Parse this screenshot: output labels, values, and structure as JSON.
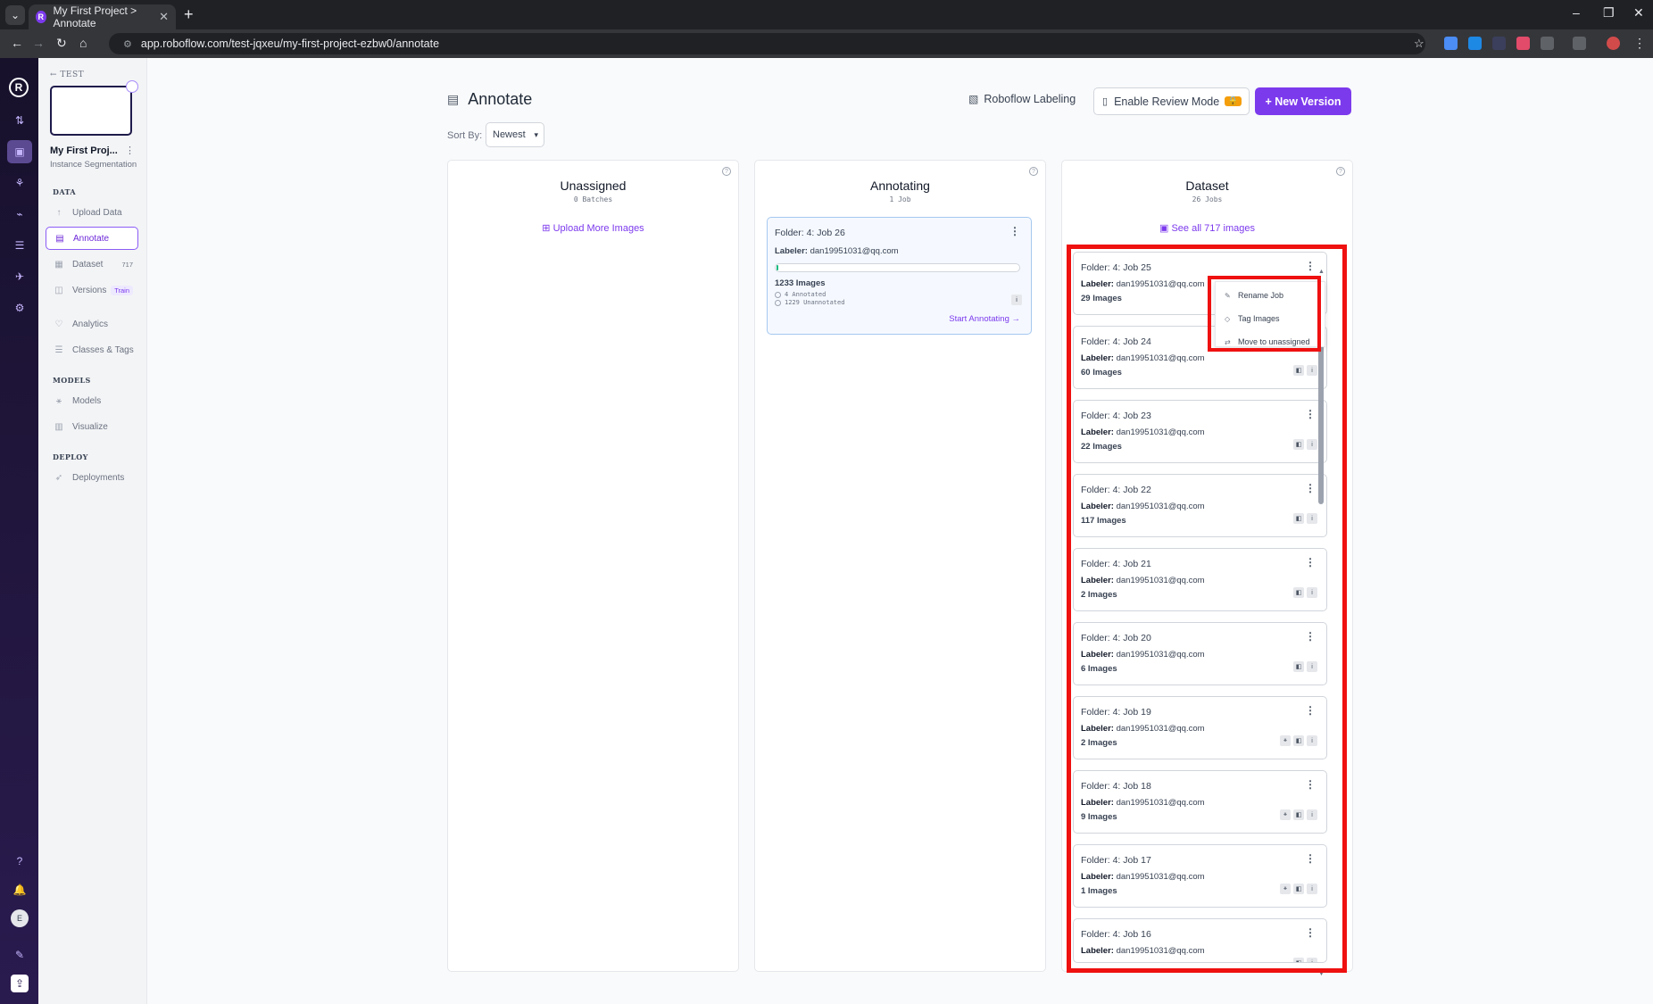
{
  "browser": {
    "tab_title": "My First Project > Annotate",
    "url": "app.roboflow.com/test-jqxeu/my-first-project-ezbw0/annotate"
  },
  "sidebar": {
    "back_label": "TEST",
    "project_name": "My First Proj...",
    "project_type": "Instance Segmentation",
    "sections": {
      "data": "DATA",
      "models": "MODELS",
      "deploy": "DEPLOY"
    },
    "items": [
      {
        "label": "Upload Data",
        "icon": "upload-icon",
        "badge": ""
      },
      {
        "label": "Annotate",
        "icon": "annotate-icon",
        "badge": ""
      },
      {
        "label": "Dataset",
        "icon": "dataset-icon",
        "badge": "717"
      },
      {
        "label": "Versions",
        "icon": "versions-icon",
        "badge": "Train"
      },
      {
        "label": "Analytics",
        "icon": "analytics-icon",
        "badge": ""
      },
      {
        "label": "Classes & Tags",
        "icon": "list-icon",
        "badge": ""
      },
      {
        "label": "Models",
        "icon": "models-icon",
        "badge": ""
      },
      {
        "label": "Visualize",
        "icon": "chart-icon",
        "badge": ""
      },
      {
        "label": "Deployments",
        "icon": "rocket-icon",
        "badge": ""
      }
    ]
  },
  "header": {
    "title": "Annotate",
    "sort_label": "Sort By:",
    "sort_value": "Newest",
    "roboflow_labeling": "Roboflow Labeling",
    "review_mode": "Enable Review Mode",
    "new_version": "+ New Version"
  },
  "columns": {
    "unassigned": {
      "title": "Unassigned",
      "subtitle": "0 Batches",
      "link": "Upload More Images"
    },
    "annotating": {
      "title": "Annotating",
      "subtitle": "1 Job",
      "link": ""
    },
    "dataset": {
      "title": "Dataset",
      "subtitle": "26 Jobs",
      "link": "See all 717 images"
    }
  },
  "annotating_job": {
    "folder": "Folder: 4: Job 26",
    "labeler_label": "Labeler:",
    "labeler": "dan19951031@qq.com",
    "images": "1233 Images",
    "annotated": "4 Annotated",
    "unannotated": "1229 Unannotated",
    "progress": 0.003,
    "start": "Start Annotating →"
  },
  "dataset_jobs": [
    {
      "folder": "Folder: 4: Job 25",
      "labeler": "dan19951031@qq.com",
      "images": "29 Images"
    },
    {
      "folder": "Folder: 4: Job 24",
      "labeler": "dan19951031@qq.com",
      "images": "60 Images"
    },
    {
      "folder": "Folder: 4: Job 23",
      "labeler": "dan19951031@qq.com",
      "images": "22 Images"
    },
    {
      "folder": "Folder: 4: Job 22",
      "labeler": "dan19951031@qq.com",
      "images": "117 Images"
    },
    {
      "folder": "Folder: 4: Job 21",
      "labeler": "dan19951031@qq.com",
      "images": "2 Images"
    },
    {
      "folder": "Folder: 4: Job 20",
      "labeler": "dan19951031@qq.com",
      "images": "6 Images"
    },
    {
      "folder": "Folder: 4: Job 19",
      "labeler": "dan19951031@qq.com",
      "images": "2 Images"
    },
    {
      "folder": "Folder: 4: Job 18",
      "labeler": "dan19951031@qq.com",
      "images": "9 Images"
    },
    {
      "folder": "Folder: 4: Job 17",
      "labeler": "dan19951031@qq.com",
      "images": "1 Images"
    },
    {
      "folder": "Folder: 4: Job 16",
      "labeler": "dan19951031@qq.com",
      "images": ""
    }
  ],
  "context_menu": {
    "rename": "Rename Job",
    "tag": "Tag Images",
    "move": "Move to unassigned"
  },
  "colors": {
    "accent": "#7c3aed",
    "highlight": "#ef1010"
  }
}
